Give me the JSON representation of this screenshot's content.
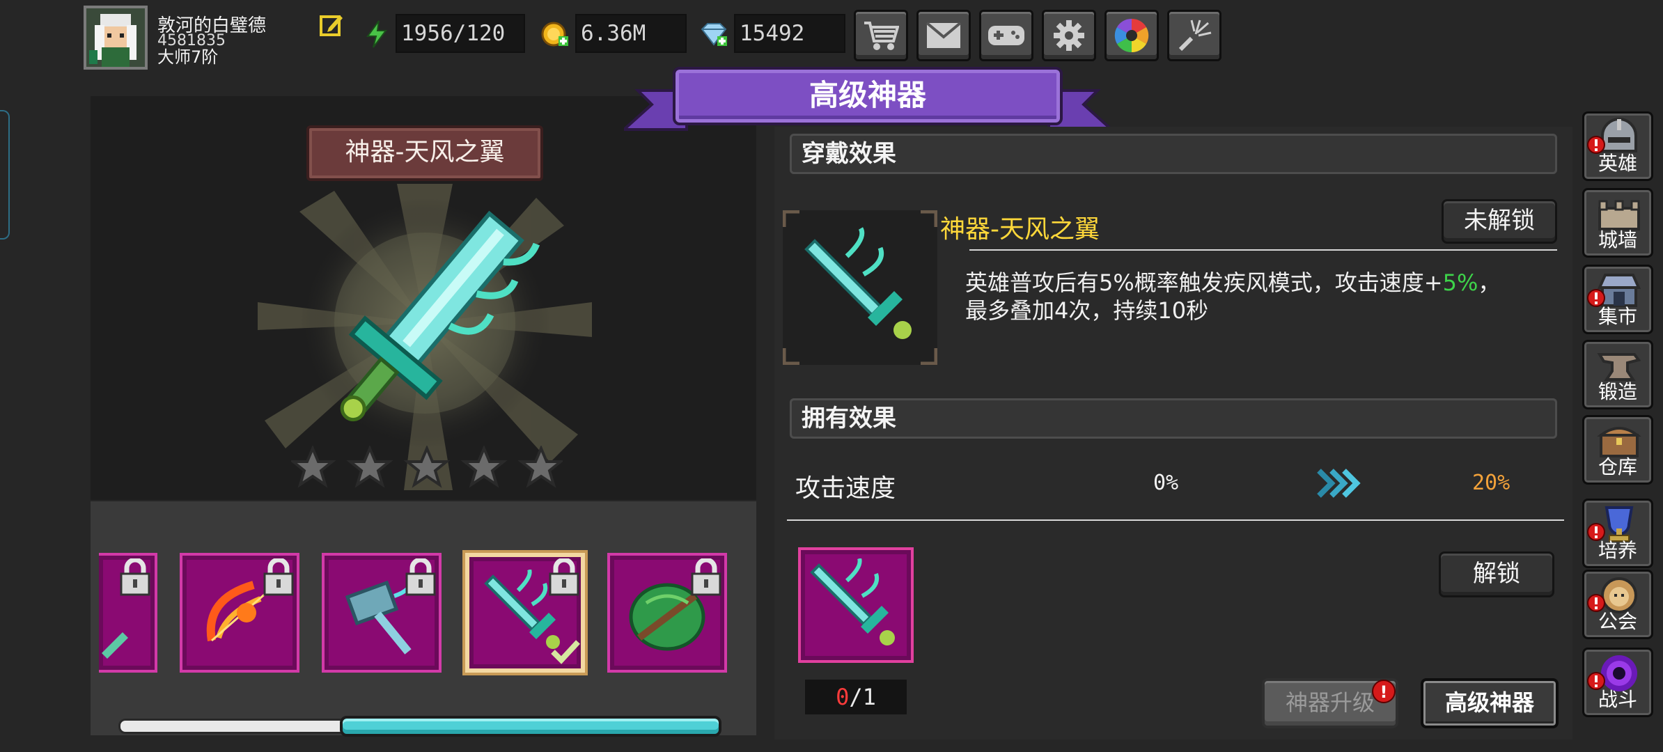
{
  "player": {
    "name": "敦河的白璧德",
    "id": "4581835",
    "rank": "大师7阶"
  },
  "resources": {
    "energy": "1956/120",
    "gold": "6.36M",
    "gems": "15492"
  },
  "top_buttons": [
    "cart-icon",
    "mail-icon",
    "gamepad-icon",
    "gear-icon",
    "aperture-icon",
    "firework-icon"
  ],
  "banner": {
    "title": "高级神器"
  },
  "artifact_view": {
    "title": "神器-天风之翼",
    "stars_total": 5,
    "stars_filled": 0
  },
  "artifact_list": {
    "scroll_position": 0.4
  },
  "wear_effect": {
    "header": "穿戴效果",
    "item_name": "神器-天风之翼",
    "status_button": "未解锁",
    "desc_line1_a": "英雄普攻后有5%概率触发疾风模式，攻击速度+",
    "desc_line1_value": "5%",
    "desc_line1_b": "，",
    "desc_line2": "最多叠加4次，持续10秒"
  },
  "own_effect": {
    "header": "拥有效果",
    "stat_name": "攻击速度",
    "from_value": "0%",
    "to_value": "20%"
  },
  "unlock": {
    "button": "解锁",
    "count_current": "0",
    "count_sep": "/",
    "count_total": "1"
  },
  "bottom_buttons": {
    "upgrade": "神器升级",
    "upgrade_badge": "!",
    "advanced": "高级神器"
  },
  "sidebar": [
    {
      "label": "英雄",
      "icon": "helmet-icon",
      "alert": true
    },
    {
      "label": "城墙",
      "icon": "wall-icon",
      "alert": false
    },
    {
      "label": "集市",
      "icon": "market-icon",
      "alert": true
    },
    {
      "label": "锻造",
      "icon": "anvil-icon",
      "alert": false
    },
    {
      "label": "仓库",
      "icon": "chest-icon",
      "alert": false
    },
    {
      "label": "培养",
      "icon": "trophy-icon",
      "alert": true
    },
    {
      "label": "公会",
      "icon": "lion-icon",
      "alert": true
    },
    {
      "label": "战斗",
      "icon": "portal-icon",
      "alert": true
    }
  ],
  "colors": {
    "rarity_frame": "#8a0a72",
    "highlight_text": "#ffd83a",
    "bonus_green": "#3ed34a",
    "target_orange": "#f3a23a",
    "banner_purple": "#7d4fc3"
  }
}
